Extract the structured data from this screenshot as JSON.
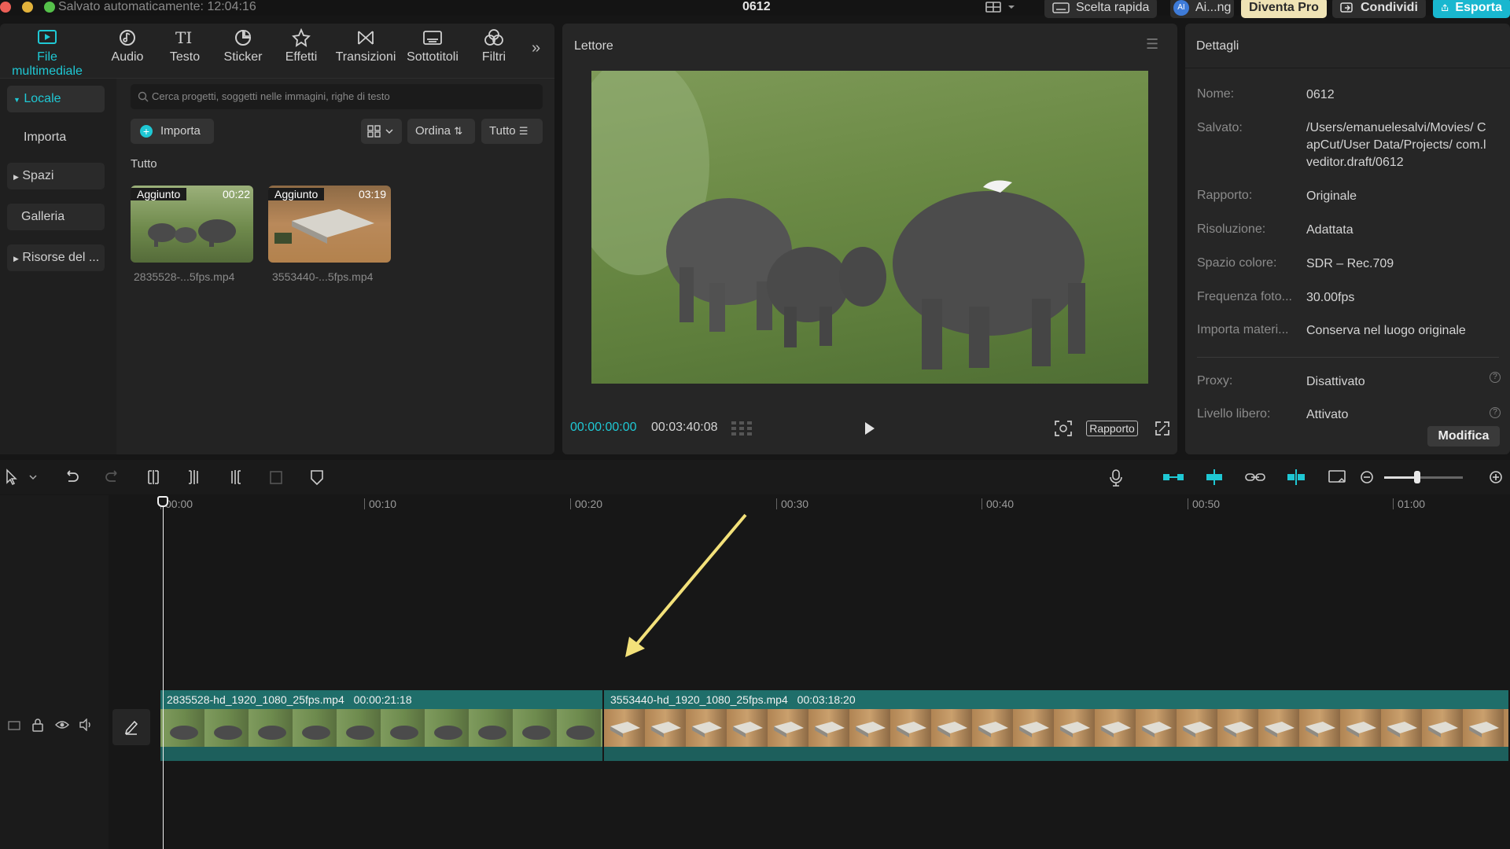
{
  "titlebar": {
    "autosave": "Salvato automaticamente: 12:04:16",
    "project_name": "0612",
    "quick": "Scelta rapida",
    "ai": "Ai...ng",
    "pro": "Diventa Pro",
    "share": "Condividi",
    "export": "Esporta"
  },
  "media_tabs": [
    {
      "label": "File multimediale",
      "icon": "media-icon"
    },
    {
      "label": "Audio",
      "icon": "audio-icon"
    },
    {
      "label": "Testo",
      "icon": "text-icon"
    },
    {
      "label": "Sticker",
      "icon": "sticker-icon"
    },
    {
      "label": "Effetti",
      "icon": "effects-icon"
    },
    {
      "label": "Transizioni",
      "icon": "transitions-icon"
    },
    {
      "label": "Sottotitoli",
      "icon": "subtitles-icon"
    },
    {
      "label": "Filtri",
      "icon": "filters-icon"
    }
  ],
  "sidebar": {
    "items": [
      {
        "label": "Locale"
      },
      {
        "label": "Importa"
      },
      {
        "label": "Spazi"
      },
      {
        "label": "Galleria"
      },
      {
        "label": "Risorse del ..."
      }
    ]
  },
  "library": {
    "search_placeholder": "Cerca progetti, soggetti nelle immagini, righe di testo",
    "import_label": "Importa",
    "sort_label": "Ordina",
    "filter_label": "Tutto",
    "section_title": "Tutto",
    "items": [
      {
        "badge": "Aggiunto",
        "duration": "00:22",
        "filename": "2835528-...5fps.mp4"
      },
      {
        "badge": "Aggiunto",
        "duration": "03:19",
        "filename": "3553440-...5fps.mp4"
      }
    ]
  },
  "player": {
    "title": "Lettore",
    "current_time": "00:00:00:00",
    "total_time": "00:03:40:08",
    "ratio_label": "Rapporto"
  },
  "details": {
    "title": "Dettagli",
    "rows": [
      {
        "label": "Nome:",
        "value": "0612"
      },
      {
        "label": "Salvato:",
        "value": "/Users/emanuelesalvi/Movies/ CapCut/User Data/Projects/ com.lveditor.draft/0612"
      },
      {
        "label": "Rapporto:",
        "value": "Originale"
      },
      {
        "label": "Risoluzione:",
        "value": "Adattata"
      },
      {
        "label": "Spazio colore:",
        "value": "SDR – Rec.709"
      },
      {
        "label": "Frequenza foto...",
        "value": "30.00fps"
      },
      {
        "label": "Importa materi...",
        "value": "Conserva nel luogo originale"
      },
      {
        "label": "Proxy:",
        "value": "Disattivato"
      },
      {
        "label": "Livello libero:",
        "value": "Attivato"
      }
    ],
    "edit_label": "Modifica"
  },
  "timeline": {
    "ticks": [
      "00:00",
      "00:10",
      "00:20",
      "00:30",
      "00:40",
      "00:50",
      "01:00"
    ],
    "clips": [
      {
        "name": "2835528-hd_1920_1080_25fps.mp4",
        "duration": "00:00:21:18"
      },
      {
        "name": "3553440-hd_1920_1080_25fps.mp4",
        "duration": "00:03:18:20"
      }
    ]
  },
  "colors": {
    "accent": "#1fc8d4",
    "clip": "#1f6e6a",
    "annotation_arrow": "#f3e17a"
  }
}
